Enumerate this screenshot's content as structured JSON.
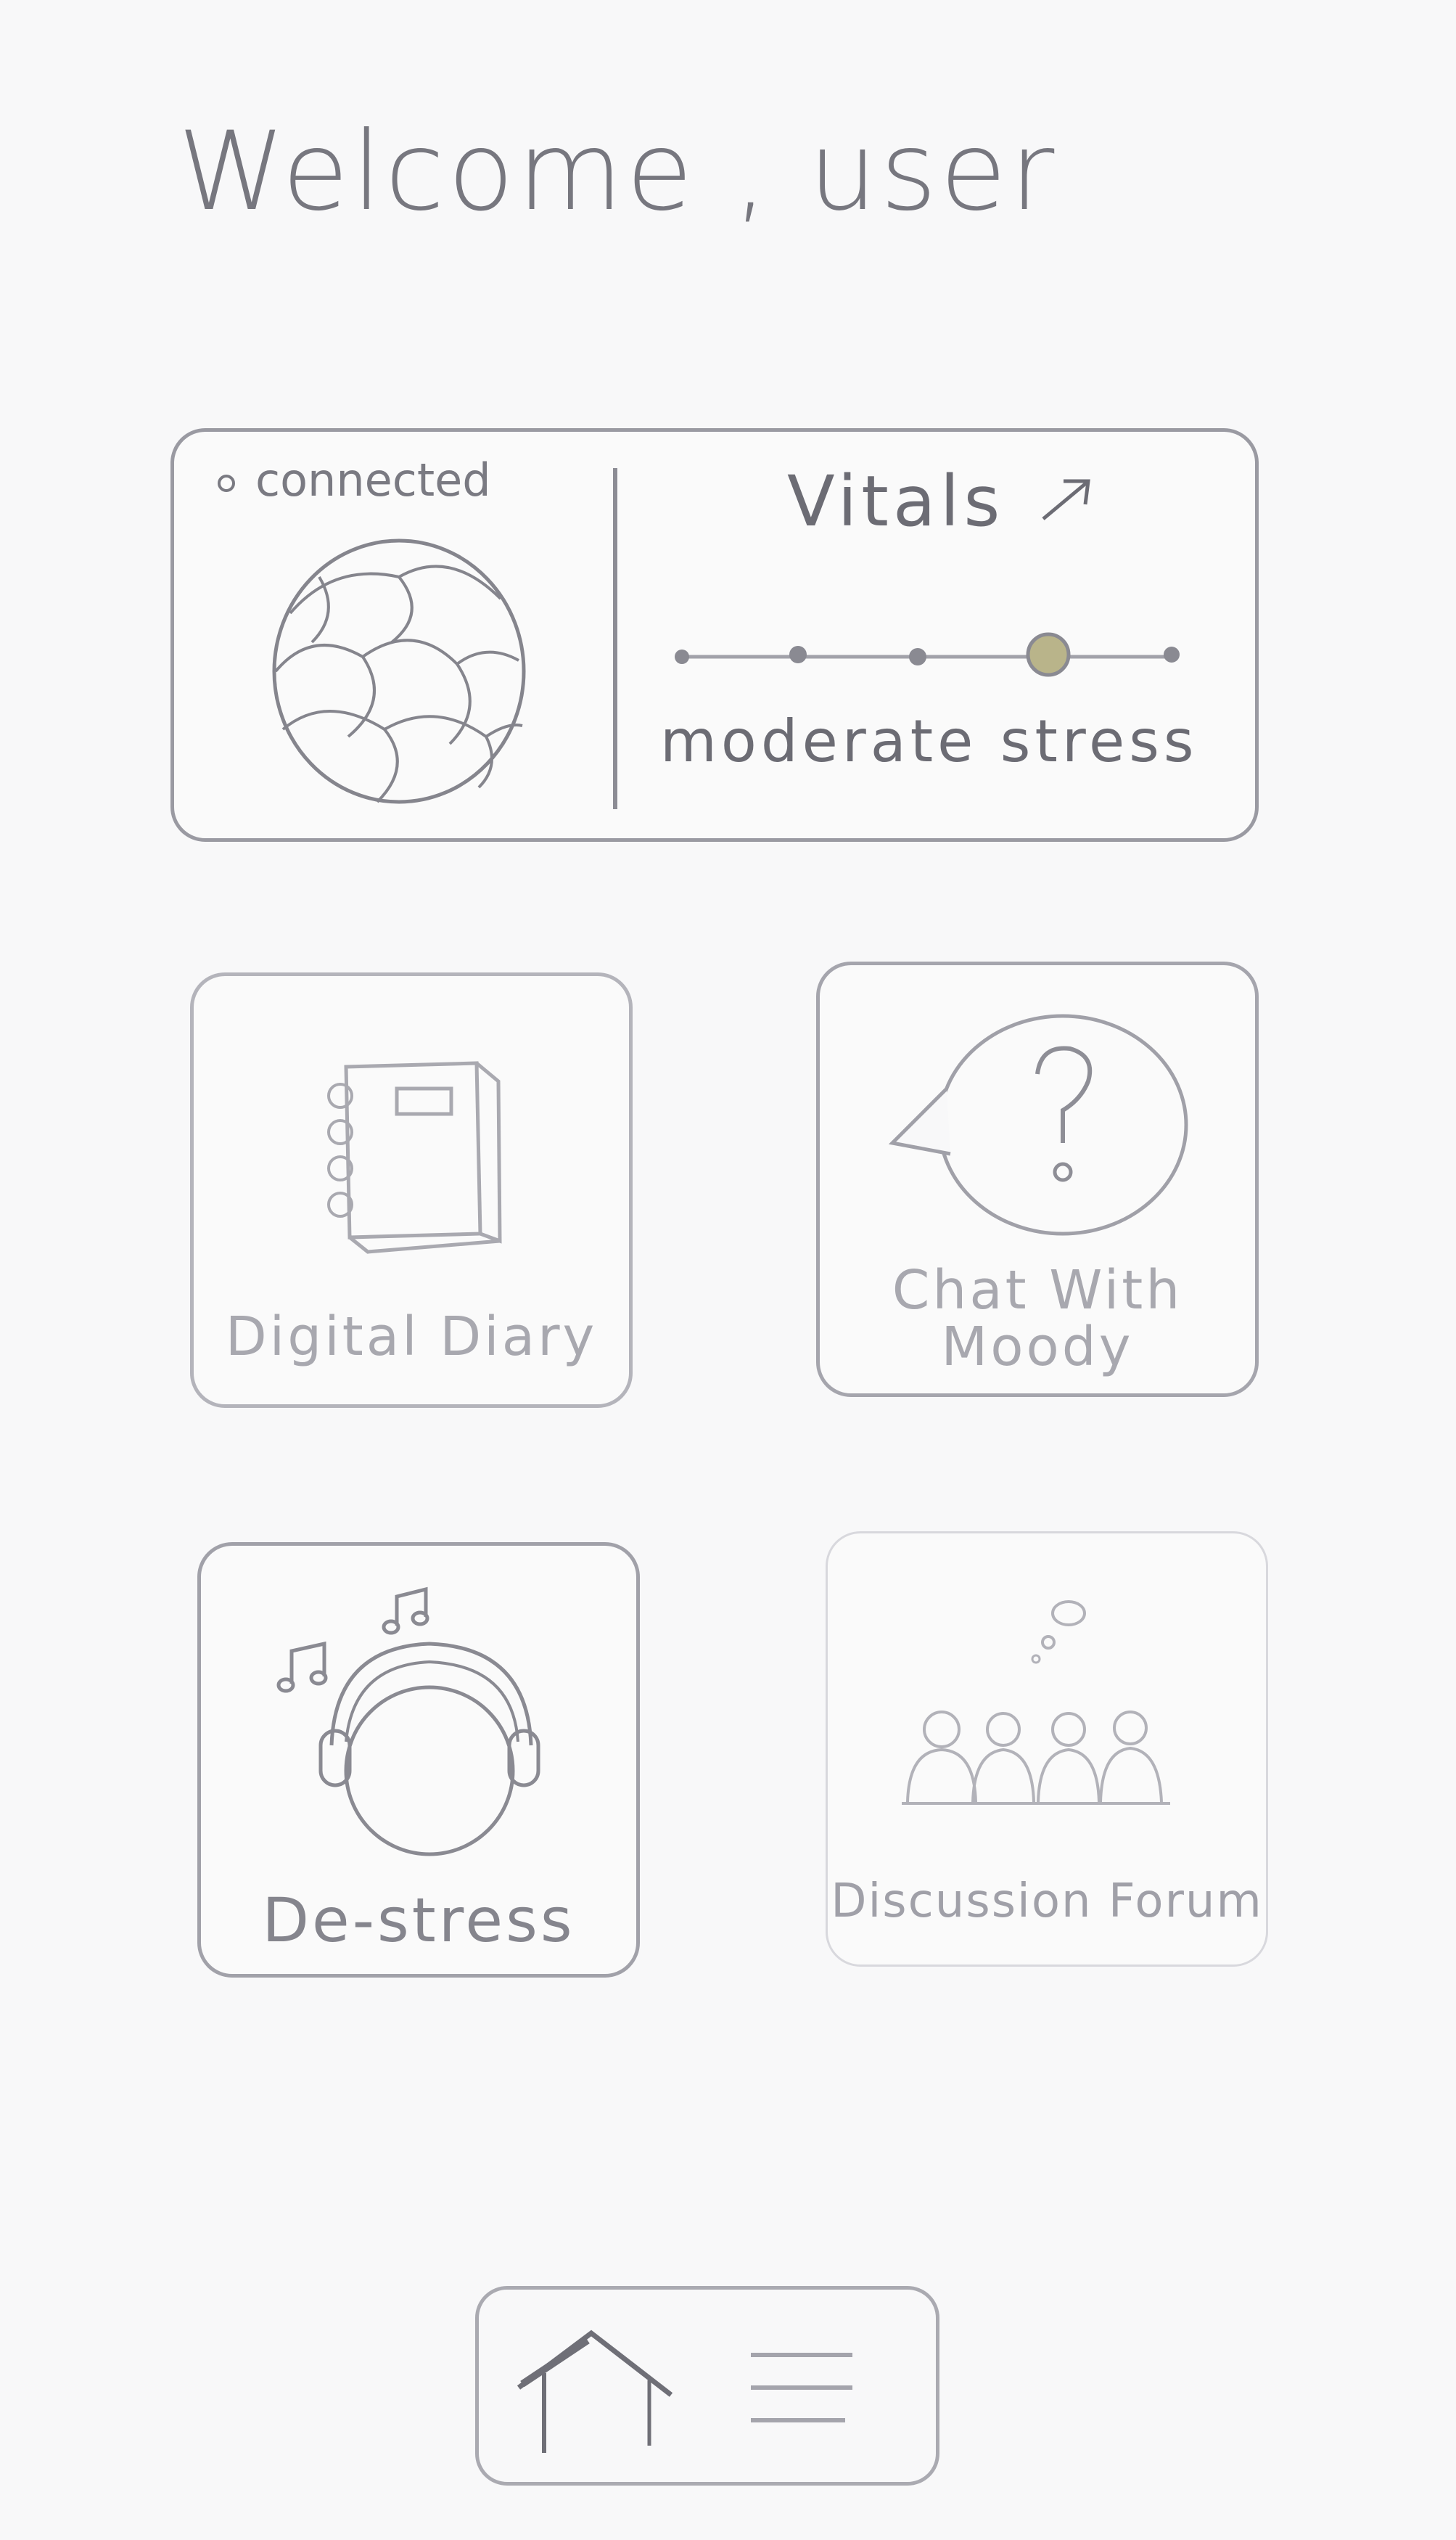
{
  "header": {
    "greeting": "Welcome , user"
  },
  "vitals_card": {
    "connection_status": "connected",
    "title": "Vitals",
    "stress_level_text": "moderate stress",
    "stress_scale": {
      "steps": 5,
      "selected_step": 4
    }
  },
  "tiles": [
    {
      "id": "digital-diary",
      "label": "Digital Diary",
      "icon": "notebook-icon"
    },
    {
      "id": "chat-with-moody",
      "label_line1": "Chat With",
      "label_line2": "Moody",
      "icon": "question-speech-bubble-icon"
    },
    {
      "id": "de-stress",
      "label": "De-stress",
      "icon": "headphones-music-icon"
    },
    {
      "id": "discussion-forum",
      "label": "Discussion Forum",
      "icon": "group-thought-bubble-icon"
    }
  ],
  "bottom_nav": {
    "items": [
      {
        "id": "home",
        "icon": "home-icon"
      },
      {
        "id": "menu",
        "icon": "hamburger-menu-icon"
      }
    ]
  },
  "colors": {
    "background": "#f8f8f9",
    "pencil_stroke": "#9a9aa2",
    "selected_scale_dot": "#b9b48a"
  }
}
